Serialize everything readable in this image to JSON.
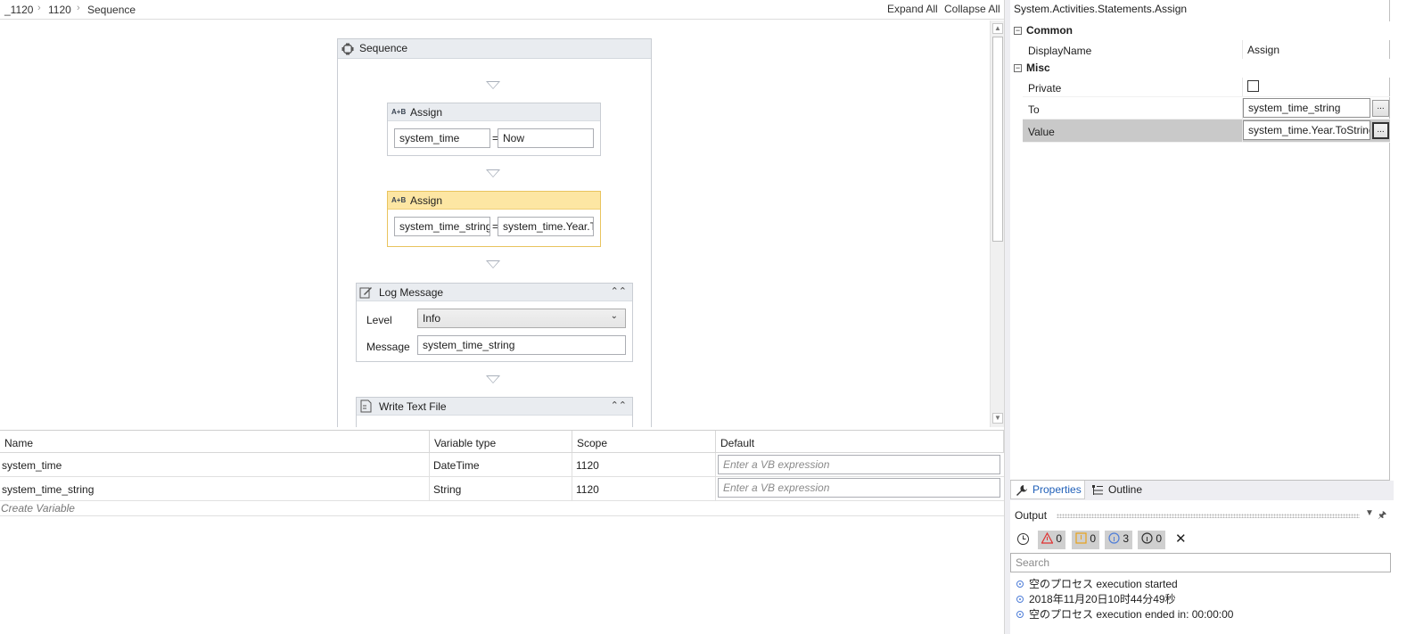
{
  "breadcrumb": [
    "_1120",
    "1120",
    "Sequence"
  ],
  "toolbar": {
    "expand_all": "Expand All",
    "collapse_all": "Collapse All"
  },
  "sequence": {
    "title": "Sequence",
    "assign1": {
      "icon": "A+B",
      "title": "Assign",
      "to": "system_time",
      "eq": "=",
      "value": "Now"
    },
    "assign2": {
      "icon": "A+B",
      "title": "Assign",
      "to": "system_time_string",
      "eq": "=",
      "value": "system_time.Year.ToString"
    },
    "log": {
      "title": "Log Message",
      "level_label": "Level",
      "level_value": "Info",
      "message_label": "Message",
      "message_value": "system_time_string"
    },
    "write": {
      "title": "Write Text File"
    }
  },
  "variables": {
    "headers": [
      "Name",
      "Variable type",
      "Scope",
      "Default"
    ],
    "rows": [
      {
        "name": "system_time",
        "type": "DateTime",
        "scope": "1120",
        "placeholder": "Enter a VB expression"
      },
      {
        "name": "system_time_string",
        "type": "String",
        "scope": "1120",
        "placeholder": "Enter a VB expression"
      }
    ],
    "create": "Create Variable"
  },
  "properties": {
    "title": "System.Activities.Statements.Assign",
    "cat_common": "Common",
    "display_name_label": "DisplayName",
    "display_name_value": "Assign",
    "cat_misc": "Misc",
    "private_label": "Private",
    "to_label": "To",
    "to_value": "system_time_string",
    "value_label": "Value",
    "value_value": "system_time.Year.ToString",
    "ellipsis": "...",
    "tab_properties": "Properties",
    "tab_outline": "Outline"
  },
  "output": {
    "title": "Output",
    "errors": "0",
    "warnings": "0",
    "info": "3",
    "trace": "0",
    "search_placeholder": "Search",
    "lines": [
      "空のプロセス execution started",
      "2018年11月20日10时44分49秒",
      "空のプロセス execution ended in: 00:00:00"
    ]
  },
  "colors": {
    "selected_header": "#fde6a3",
    "accent_tab": "#1f5fb8",
    "error": "#e03131",
    "warning": "#e8a21a",
    "info": "#4f7ed8"
  }
}
